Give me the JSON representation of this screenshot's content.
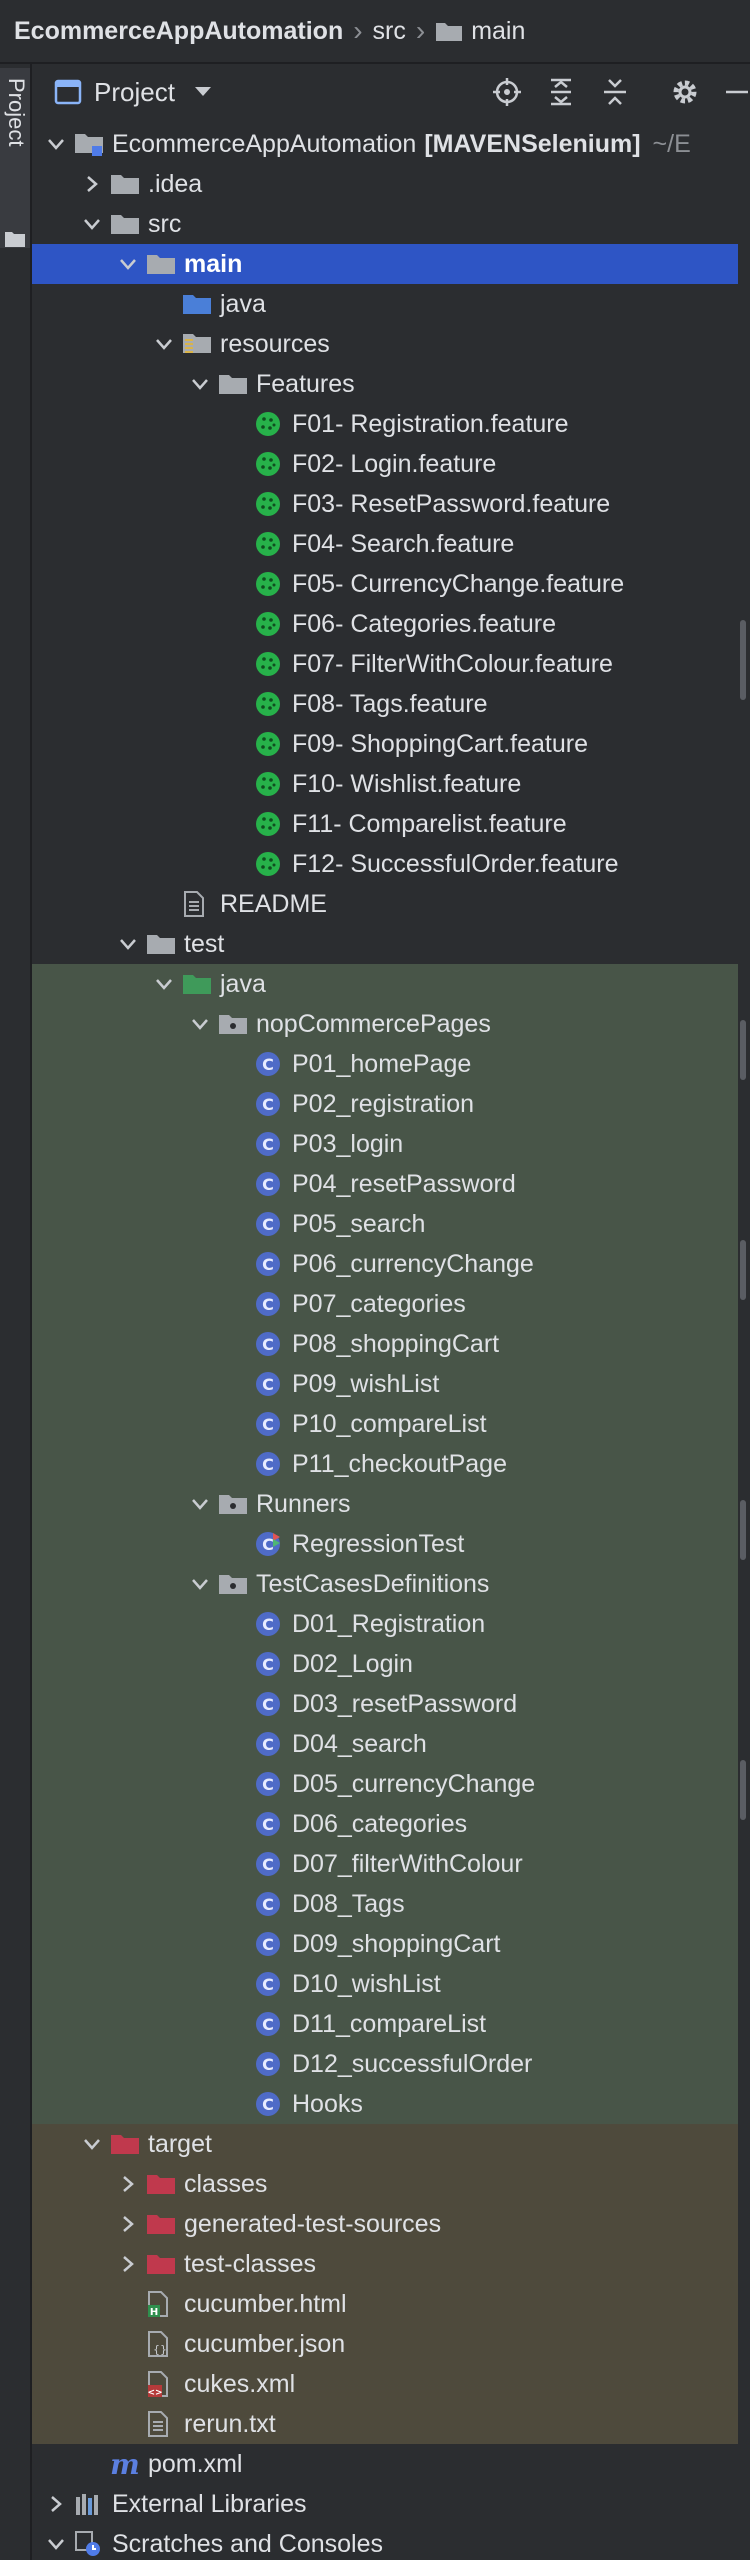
{
  "breadcrumb": {
    "root": "EcommerceAppAutomation",
    "seg1": "src",
    "seg2": "main"
  },
  "side": {
    "tab_label": "Project"
  },
  "toolbar": {
    "title": "Project"
  },
  "colors": {
    "selection": "#2e55c5",
    "test_band": "#485548",
    "target_band": "#4e4a3c",
    "background": "#2b2d30"
  },
  "tree": [
    {
      "label": "EcommerceAppAutomation",
      "badge": "[MAVENSelenium]",
      "path": "~/E",
      "icon": "module-folder-icon",
      "arrow": "down",
      "level": 0
    },
    {
      "label": ".idea",
      "icon": "folder-icon",
      "arrow": "right",
      "level": 1
    },
    {
      "label": "src",
      "icon": "folder-icon",
      "arrow": "down",
      "level": 1
    },
    {
      "label": "main",
      "icon": "folder-icon",
      "arrow": "down",
      "level": 2,
      "selected": true
    },
    {
      "label": "java",
      "icon": "source-folder-icon",
      "level": 3
    },
    {
      "label": "resources",
      "icon": "resources-folder-icon",
      "arrow": "down",
      "level": 3
    },
    {
      "label": "Features",
      "icon": "folder-icon",
      "arrow": "down",
      "level": 4
    },
    {
      "label": "F01- Registration.feature",
      "icon": "cucumber-icon",
      "level": 5
    },
    {
      "label": "F02- Login.feature",
      "icon": "cucumber-icon",
      "level": 5
    },
    {
      "label": "F03- ResetPassword.feature",
      "icon": "cucumber-icon",
      "level": 5
    },
    {
      "label": "F04- Search.feature",
      "icon": "cucumber-icon",
      "level": 5
    },
    {
      "label": "F05- CurrencyChange.feature",
      "icon": "cucumber-icon",
      "level": 5
    },
    {
      "label": "F06- Categories.feature",
      "icon": "cucumber-icon",
      "level": 5
    },
    {
      "label": "F07- FilterWithColour.feature",
      "icon": "cucumber-icon",
      "level": 5
    },
    {
      "label": "F08- Tags.feature",
      "icon": "cucumber-icon",
      "level": 5
    },
    {
      "label": "F09- ShoppingCart.feature",
      "icon": "cucumber-icon",
      "level": 5
    },
    {
      "label": "F10- Wishlist.feature",
      "icon": "cucumber-icon",
      "level": 5
    },
    {
      "label": "F11- Comparelist.feature",
      "icon": "cucumber-icon",
      "level": 5
    },
    {
      "label": "F12- SuccessfulOrder.feature",
      "icon": "cucumber-icon",
      "level": 5
    },
    {
      "label": "README",
      "icon": "text-file-icon",
      "level": 3
    },
    {
      "label": "test",
      "icon": "folder-icon",
      "arrow": "down",
      "level": 2
    },
    {
      "label": "java",
      "icon": "test-source-folder-icon",
      "arrow": "down",
      "level": 3,
      "band": "test"
    },
    {
      "label": "nopCommercePages",
      "icon": "package-icon",
      "arrow": "down",
      "level": 4,
      "band": "test"
    },
    {
      "label": "P01_homePage",
      "icon": "class-icon",
      "level": 5,
      "band": "test"
    },
    {
      "label": "P02_registration",
      "icon": "class-icon",
      "level": 5,
      "band": "test"
    },
    {
      "label": "P03_login",
      "icon": "class-icon",
      "level": 5,
      "band": "test"
    },
    {
      "label": "P04_resetPassword",
      "icon": "class-icon",
      "level": 5,
      "band": "test"
    },
    {
      "label": "P05_search",
      "icon": "class-icon",
      "level": 5,
      "band": "test"
    },
    {
      "label": "P06_currencyChange",
      "icon": "class-icon",
      "level": 5,
      "band": "test"
    },
    {
      "label": "P07_categories",
      "icon": "class-icon",
      "level": 5,
      "band": "test"
    },
    {
      "label": "P08_shoppingCart",
      "icon": "class-icon",
      "level": 5,
      "band": "test"
    },
    {
      "label": "P09_wishList",
      "icon": "class-icon",
      "level": 5,
      "band": "test"
    },
    {
      "label": "P10_compareList",
      "icon": "class-icon",
      "level": 5,
      "band": "test"
    },
    {
      "label": "P11_checkoutPage",
      "icon": "class-icon",
      "level": 5,
      "band": "test"
    },
    {
      "label": "Runners",
      "icon": "package-icon",
      "arrow": "down",
      "level": 4,
      "band": "test"
    },
    {
      "label": "RegressionTest",
      "icon": "test-class-icon",
      "level": 5,
      "band": "test"
    },
    {
      "label": "TestCasesDefinitions",
      "icon": "package-icon",
      "arrow": "down",
      "level": 4,
      "band": "test"
    },
    {
      "label": "D01_Registration",
      "icon": "class-icon",
      "level": 5,
      "band": "test"
    },
    {
      "label": "D02_Login",
      "icon": "class-icon",
      "level": 5,
      "band": "test"
    },
    {
      "label": "D03_resetPassword",
      "icon": "class-icon",
      "level": 5,
      "band": "test"
    },
    {
      "label": "D04_search",
      "icon": "class-icon",
      "level": 5,
      "band": "test"
    },
    {
      "label": "D05_currencyChange",
      "icon": "class-icon",
      "level": 5,
      "band": "test"
    },
    {
      "label": "D06_categories",
      "icon": "class-icon",
      "level": 5,
      "band": "test"
    },
    {
      "label": "D07_filterWithColour",
      "icon": "class-icon",
      "level": 5,
      "band": "test"
    },
    {
      "label": "D08_Tags",
      "icon": "class-icon",
      "level": 5,
      "band": "test"
    },
    {
      "label": "D09_shoppingCart",
      "icon": "class-icon",
      "level": 5,
      "band": "test"
    },
    {
      "label": "D10_wishList",
      "icon": "class-icon",
      "level": 5,
      "band": "test"
    },
    {
      "label": "D11_compareList",
      "icon": "class-icon",
      "level": 5,
      "band": "test"
    },
    {
      "label": "D12_successfulOrder",
      "icon": "class-icon",
      "level": 5,
      "band": "test"
    },
    {
      "label": "Hooks",
      "icon": "class-icon",
      "level": 5,
      "band": "test"
    },
    {
      "label": "target",
      "icon": "excluded-folder-icon",
      "arrow": "down",
      "level": 1,
      "band": "target"
    },
    {
      "label": "classes",
      "icon": "excluded-folder-icon",
      "arrow": "right",
      "level": 2,
      "band": "target"
    },
    {
      "label": "generated-test-sources",
      "icon": "excluded-folder-icon",
      "arrow": "right",
      "level": 2,
      "band": "target"
    },
    {
      "label": "test-classes",
      "icon": "excluded-folder-icon",
      "arrow": "right",
      "level": 2,
      "band": "target"
    },
    {
      "label": "cucumber.html",
      "icon": "html-file-icon",
      "level": 2,
      "band": "target"
    },
    {
      "label": "cucumber.json",
      "icon": "json-file-icon",
      "level": 2,
      "band": "target"
    },
    {
      "label": "cukes.xml",
      "icon": "xml-file-icon",
      "level": 2,
      "band": "target"
    },
    {
      "label": "rerun.txt",
      "icon": "text-file-icon",
      "level": 2,
      "band": "target"
    },
    {
      "label": "pom.xml",
      "icon": "maven-icon",
      "level": 1
    },
    {
      "label": "External Libraries",
      "icon": "libraries-icon",
      "arrow": "right",
      "level": 0
    },
    {
      "label": "Scratches and Consoles",
      "icon": "scratches-icon",
      "arrow": "down",
      "level": 0
    }
  ]
}
